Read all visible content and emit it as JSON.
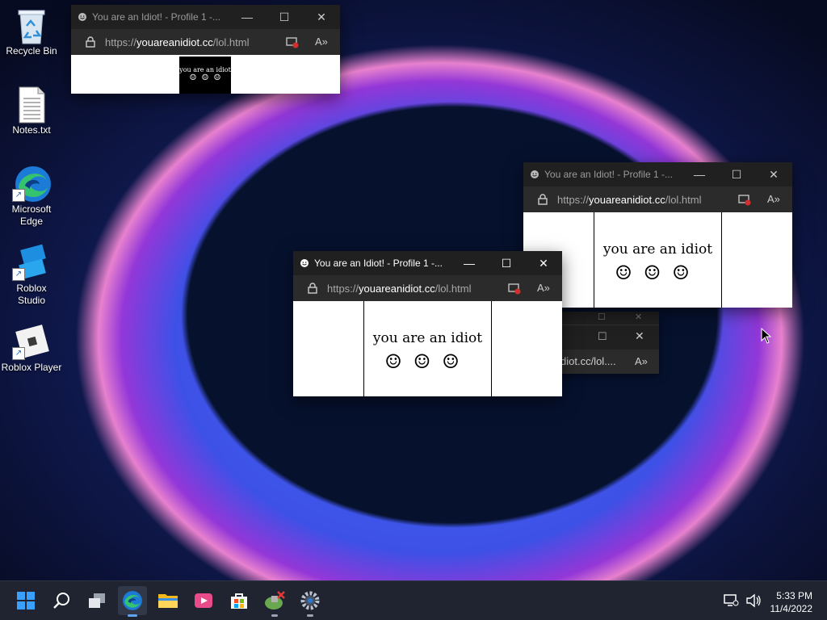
{
  "desktop": {
    "icons": [
      {
        "label": "Recycle Bin"
      },
      {
        "label": "Notes.txt"
      },
      {
        "label": "Microsoft Edge"
      },
      {
        "label": "Roblox Studio"
      },
      {
        "label": "Roblox Player"
      }
    ]
  },
  "windows": {
    "title": "You are an Idiot! - Profile 1 -...",
    "url_prefix": "https://",
    "url_domain": "youareanidiot.cc",
    "url_path": "/lol.html",
    "page_text": "you are an idiot",
    "faces": "☺☺☺",
    "partial_url": "diot.cc/lol...."
  },
  "taskbar": {
    "items": [
      "start-icon",
      "search-icon",
      "task-view-icon",
      "edge-icon",
      "file-explorer-icon",
      "clipchamp-icon",
      "store-icon",
      "roblox-studio-icon",
      "settings-icon"
    ],
    "time": "5:33 PM",
    "date": "11/4/2022"
  }
}
